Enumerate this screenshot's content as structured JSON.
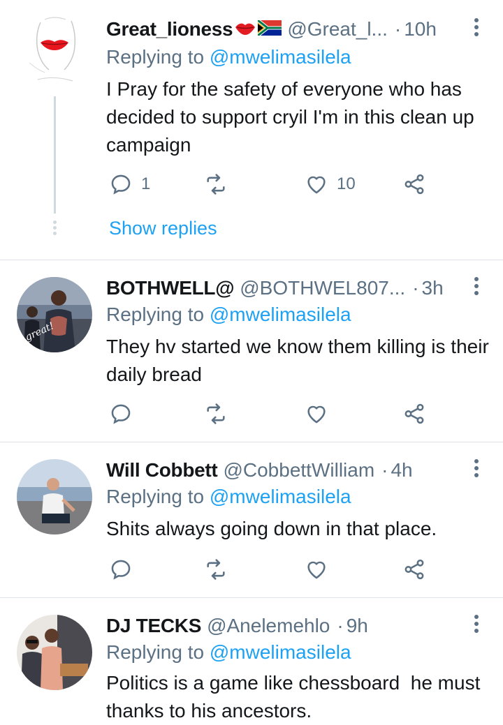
{
  "accent_color": "#1da1f2",
  "secondary_text_color": "#5b7083",
  "tweets": [
    {
      "name": "Great_lioness",
      "emojis": [
        "lips",
        "south-africa-flag"
      ],
      "handle": "@Great_l...",
      "separator": "·",
      "time": "10h",
      "replying_prefix": "Replying to",
      "replying_to": "@mwelimasilela",
      "text": "I Pray for the safety of everyone who has decided to support cryil I'm in this clean up campaign",
      "reply_count": "1",
      "retweet_count": "",
      "like_count": "10",
      "show_replies": "Show replies"
    },
    {
      "name": "BOTHWELL@",
      "handle": "@BOTHWEL807...",
      "separator": "·",
      "time": "3h",
      "replying_prefix": "Replying to",
      "replying_to": "@mwelimasilela",
      "text": "They hv started we know them killing is their daily bread",
      "reply_count": "",
      "retweet_count": "",
      "like_count": "",
      "avatar_caption": "great!"
    },
    {
      "name": "Will Cobbett",
      "handle": "@CobbettWilliam",
      "separator": "·",
      "time": "4h",
      "replying_prefix": "Replying to",
      "replying_to": "@mwelimasilela",
      "text": "Shits always going down in that place.",
      "reply_count": "",
      "retweet_count": "",
      "like_count": ""
    },
    {
      "name": "DJ TECKS",
      "handle": "@Anelemehlo",
      "separator": "·",
      "time": "9h",
      "replying_prefix": "Replying to",
      "replying_to": "@mwelimasilela",
      "text": "Politics is a game like chessboard  he must thanks to his ancestors."
    }
  ]
}
